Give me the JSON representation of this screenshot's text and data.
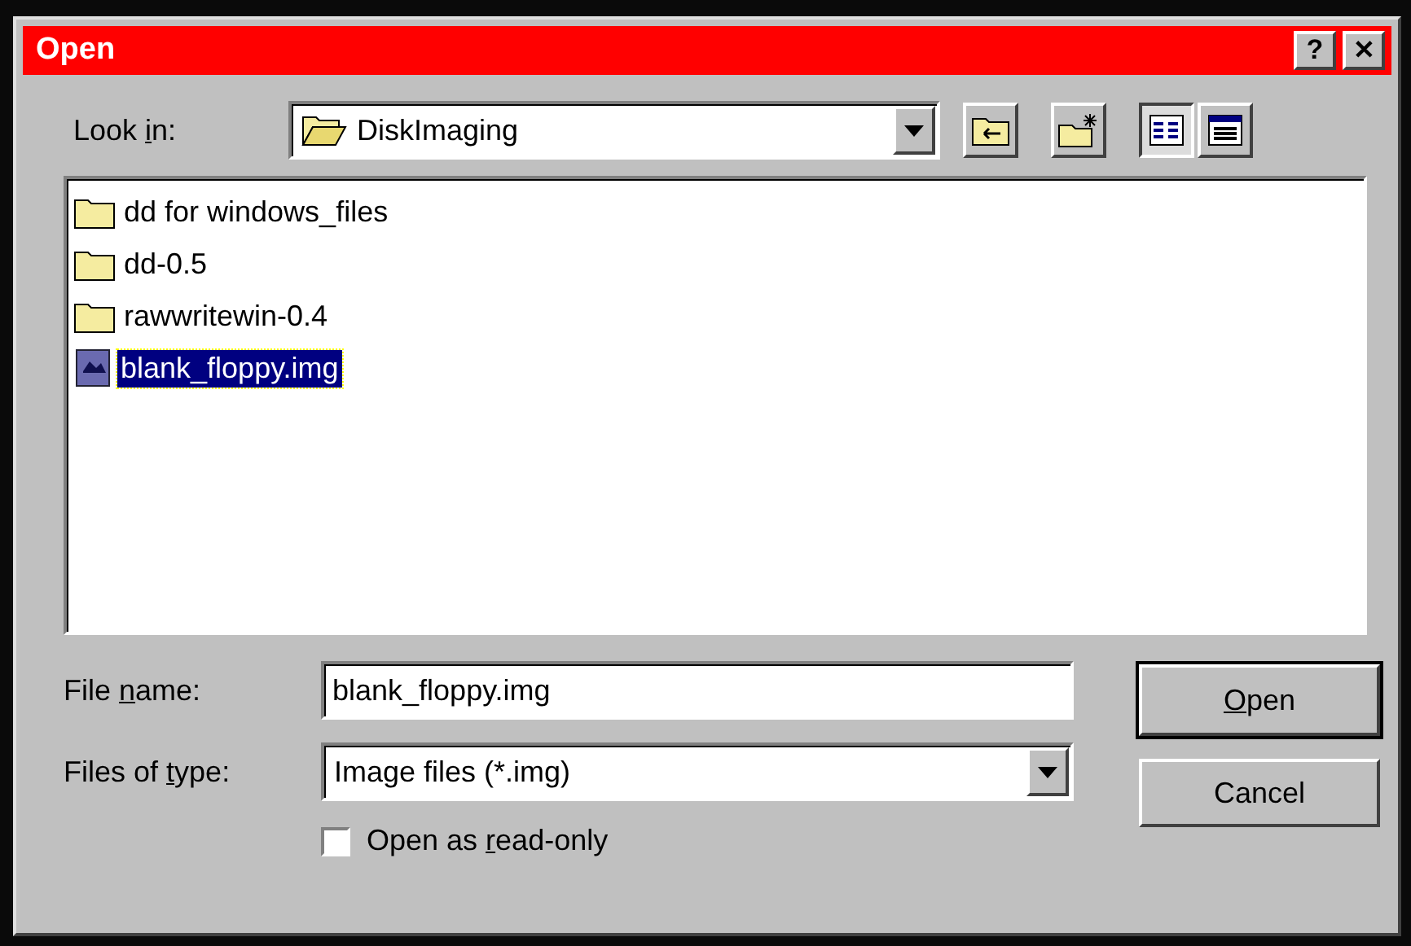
{
  "window": {
    "title": "Open",
    "buttons": [
      {
        "kind": "help",
        "label": "?"
      },
      {
        "kind": "close",
        "label": "✕"
      }
    ]
  },
  "look_in": {
    "label_parts": [
      {
        "text": "Look ",
        "underline": false
      },
      {
        "text": "i",
        "underline": true
      },
      {
        "text": "n:",
        "underline": false
      }
    ],
    "value": "DiskImaging"
  },
  "toolbar": [
    {
      "kind": "up",
      "selected": false
    },
    {
      "kind": "new_folder",
      "selected": false
    },
    {
      "kind": "list",
      "selected": true
    },
    {
      "kind": "details",
      "selected": false
    }
  ],
  "files": [
    {
      "kind": "folder",
      "name": "dd for windows_files",
      "selected": false
    },
    {
      "kind": "folder",
      "name": "dd-0.5",
      "selected": false
    },
    {
      "kind": "folder",
      "name": "rawwritewin-0.4",
      "selected": false
    },
    {
      "kind": "file",
      "name": "blank_floppy.img",
      "selected": true
    }
  ],
  "file_name": {
    "label_parts": [
      {
        "text": "File ",
        "underline": false
      },
      {
        "text": "n",
        "underline": true
      },
      {
        "text": "ame:",
        "underline": false
      }
    ],
    "value": "blank_floppy.img"
  },
  "file_type": {
    "label_parts": [
      {
        "text": "Files of ",
        "underline": false
      },
      {
        "text": "t",
        "underline": true
      },
      {
        "text": "ype:",
        "underline": false
      }
    ],
    "value": "Image files (*.img)"
  },
  "read_only": {
    "label_parts": [
      {
        "text": "Open as ",
        "underline": false
      },
      {
        "text": "r",
        "underline": true
      },
      {
        "text": "ead-only",
        "underline": false
      }
    ],
    "checked": false
  },
  "buttons": [
    {
      "label_parts": [
        {
          "text": "O",
          "underline": true
        },
        {
          "text": "pen",
          "underline": false
        }
      ],
      "default": true
    },
    {
      "label_parts": [
        {
          "text": "Cancel",
          "underline": false
        }
      ],
      "default": false
    }
  ]
}
